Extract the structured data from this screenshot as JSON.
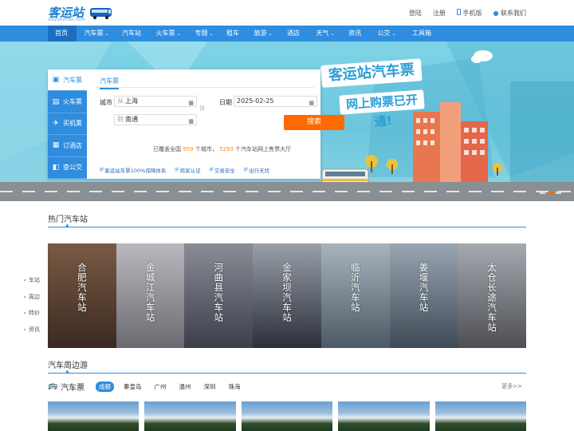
{
  "header": {
    "logo_text": "客运站",
    "logo_sub": "Keyunzhan.com",
    "links": {
      "login": "登陆",
      "register": "注册",
      "mobile": "手机版",
      "contact": "联系我们"
    }
  },
  "nav": {
    "items": [
      {
        "label": "首页",
        "caret": ""
      },
      {
        "label": "汽车票",
        "caret": "⌄"
      },
      {
        "label": "汽车站",
        "caret": ""
      },
      {
        "label": "火车票",
        "caret": "⌄"
      },
      {
        "label": "专题",
        "caret": "⌄"
      },
      {
        "label": "租车",
        "caret": ""
      },
      {
        "label": "旅游",
        "caret": "⌄"
      },
      {
        "label": "酒店",
        "caret": ""
      },
      {
        "label": "天气",
        "caret": "⌄"
      },
      {
        "label": "资讯",
        "caret": ""
      },
      {
        "label": "公交",
        "caret": "⌄"
      },
      {
        "label": "工具箱",
        "caret": ""
      }
    ]
  },
  "search": {
    "side_tabs": [
      {
        "label": "汽车票",
        "icon": "bus-icon"
      },
      {
        "label": "火车票",
        "icon": "train-icon"
      },
      {
        "label": "买机票",
        "icon": "plane-icon"
      },
      {
        "label": "订酒店",
        "icon": "hotel-icon"
      },
      {
        "label": "查公交",
        "icon": "bus-stop-icon"
      }
    ],
    "form_tab": "汽车票",
    "city_label": "城市",
    "from_prefix": "从",
    "from_value": "上海",
    "to_prefix": "到",
    "to_value": "南通",
    "swap_label": "换",
    "date_label": "日期",
    "date_value": "2025-02-25",
    "search_button": "搜索",
    "stat_prefix": "已覆盖全国",
    "stat_cities": "959",
    "stat_mid": "个城市，",
    "stat_stations": "5293",
    "stat_suffix": "个汽车站网上售票大厅",
    "guarantees": [
      "客运站车票100%保障体系",
      "商家认证",
      "交易安全",
      "出行无忧"
    ]
  },
  "promo": {
    "line1": "客运站汽车票",
    "line2": "网上购票已开通!"
  },
  "hot": {
    "title": "热门汽车站",
    "stations": [
      {
        "name": "合肥汽车站",
        "c1": "#3a2a22",
        "c2": "#7a5a44"
      },
      {
        "name": "金城江汽车站",
        "c1": "#6a6a70",
        "c2": "#b9b9bf"
      },
      {
        "name": "河曲县汽车站",
        "c1": "#3b3f4a",
        "c2": "#8a8c96"
      },
      {
        "name": "金家坝汽车站",
        "c1": "#2a2f3a",
        "c2": "#9aa0aa"
      },
      {
        "name": "临沂汽车站",
        "c1": "#4c5a66",
        "c2": "#a8b4bc"
      },
      {
        "name": "姜堰汽车站",
        "c1": "#3e4a55",
        "c2": "#99a6b1"
      },
      {
        "name": "太仓长途汽车站",
        "c1": "#4d4f55",
        "c2": "#a6a9af"
      }
    ]
  },
  "float_nav": [
    "车站",
    "周边",
    "特价",
    "资讯"
  ],
  "tour": {
    "section_title": "汽车周边游",
    "row_title": "汽车票",
    "cities": [
      "成都",
      "秦皇岛",
      "广州",
      "温州",
      "深圳",
      "珠海"
    ],
    "more": "更多>>"
  }
}
